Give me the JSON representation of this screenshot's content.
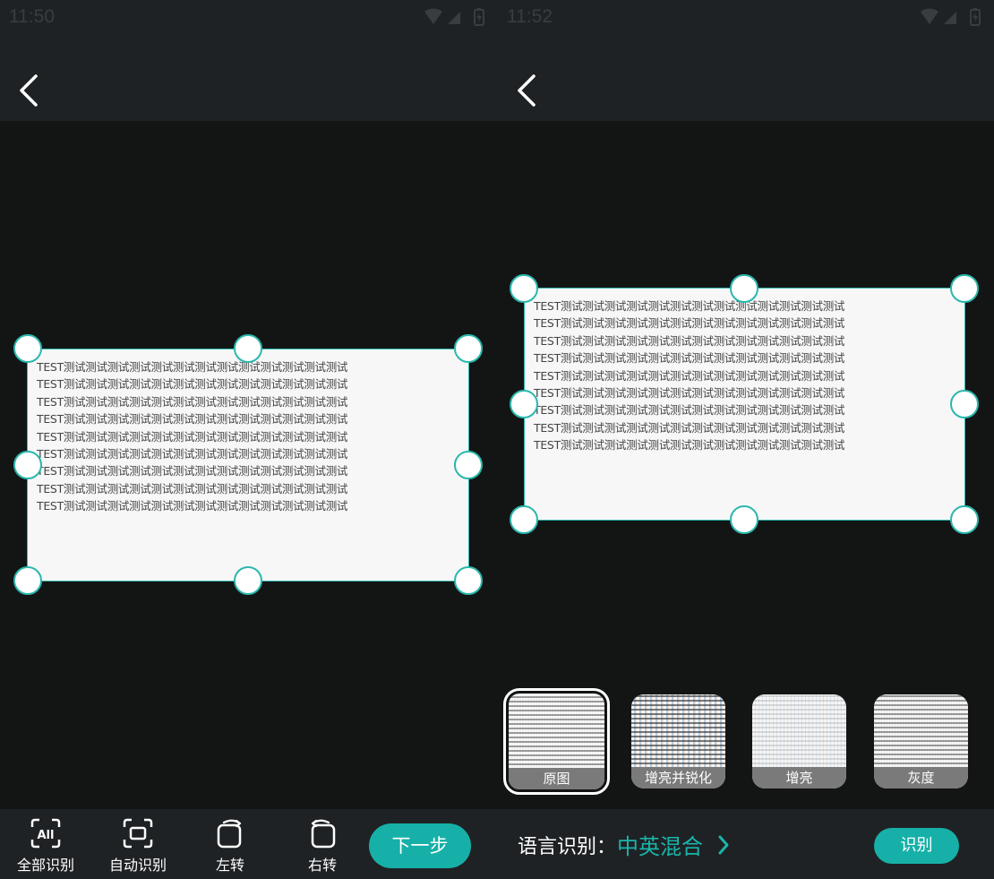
{
  "left_screen": {
    "status_time": "11:50",
    "document_lines": [
      "TEST测试测试测试测试测试测试测试测试测试测试测试测试测试",
      "TEST测试测试测试测试测试测试测试测试测试测试测试测试测试",
      "TEST测试测试测试测试测试测试测试测试测试测试测试测试测试",
      "TEST测试测试测试测试测试测试测试测试测试测试测试测试测试",
      "TEST测试测试测试测试测试测试测试测试测试测试测试测试测试",
      "TEST测试测试测试测试测试测试测试测试测试测试测试测试测试",
      "TEST测试测试测试测试测试测试测试测试测试测试测试测试测试",
      "TEST测试测试测试测试测试测试测试测试测试测试测试测试测试",
      "TEST测试测试测试测试测试测试测试测试测试测试测试测试测试"
    ],
    "toolbar": {
      "recognize_all": "全部识别",
      "auto_recognize": "自动识别",
      "rotate_left": "左转",
      "rotate_right": "右转",
      "next_step": "下一步"
    }
  },
  "right_screen": {
    "status_time": "11:52",
    "document_lines": [
      "TEST测试测试测试测试测试测试测试测试测试测试测试测试测试",
      "TEST测试测试测试测试测试测试测试测试测试测试测试测试测试",
      "TEST测试测试测试测试测试测试测试测试测试测试测试测试测试",
      "TEST测试测试测试测试测试测试测试测试测试测试测试测试测试",
      "TEST测试测试测试测试测试测试测试测试测试测试测试测试测试",
      "TEST测试测试测试测试测试测试测试测试测试测试测试测试测试",
      "TEST测试测试测试测试测试测试测试测试测试测试测试测试测试",
      "TEST测试测试测试测试测试测试测试测试测试测试测试测试测试",
      "TEST测试测试测试测试测试测试测试测试测试测试测试测试测试"
    ],
    "filters": [
      {
        "label": "原图",
        "selected": true
      },
      {
        "label": "增亮并锐化",
        "selected": false
      },
      {
        "label": "增亮",
        "selected": false
      },
      {
        "label": "灰度",
        "selected": false
      }
    ],
    "language_label": "语言识别：",
    "language_value": "中英混合",
    "recognize_button": "识别"
  },
  "colors": {
    "accent": "#16b0a8",
    "crop_border": "#2ab7ad",
    "background": "#131515",
    "bar": "#1f2224"
  },
  "icons": [
    "back-arrow-icon",
    "wifi-icon",
    "signal-icon",
    "battery-icon",
    "scan-all-icon",
    "scan-auto-icon",
    "rotate-left-icon",
    "rotate-right-icon",
    "chevron-right-icon"
  ]
}
